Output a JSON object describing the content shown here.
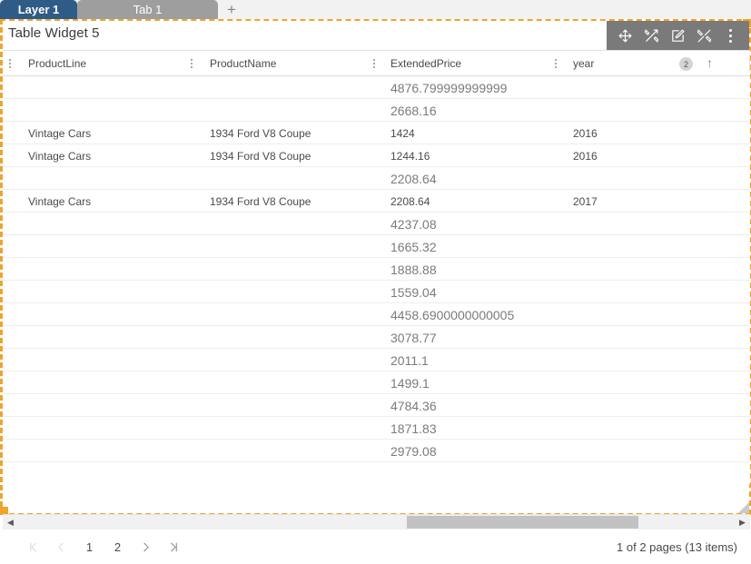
{
  "tabbar": {
    "layer_tab": "Layer 1",
    "sheet_tab": "Tab 1",
    "add_tab": "+"
  },
  "widget": {
    "title": "Table Widget 5",
    "toolbar": [
      {
        "name": "move-icon",
        "label": "Move"
      },
      {
        "name": "design-icon",
        "label": "Design"
      },
      {
        "name": "edit-icon",
        "label": "Edit"
      },
      {
        "name": "tools-icon",
        "label": "Tools"
      },
      {
        "name": "more-menu-icon",
        "label": "More"
      }
    ]
  },
  "table": {
    "columns": [
      {
        "key": "ProductLine",
        "label": "ProductLine"
      },
      {
        "key": "ProductName",
        "label": "ProductName"
      },
      {
        "key": "ExtendedPrice",
        "label": "ExtendedPrice"
      },
      {
        "key": "year",
        "label": "year"
      }
    ],
    "sort": {
      "column": "year",
      "order_badge": "2",
      "direction": "ascending",
      "arrow": "↑"
    },
    "rows": [
      {
        "ProductLine": "",
        "ProductName": "",
        "ExtendedPrice": "4876.799999999999",
        "year": "",
        "summary": true
      },
      {
        "ProductLine": "",
        "ProductName": "",
        "ExtendedPrice": "2668.16",
        "year": "",
        "summary": true
      },
      {
        "ProductLine": "Vintage Cars",
        "ProductName": "1934 Ford V8 Coupe",
        "ExtendedPrice": "1424",
        "year": "2016",
        "summary": false
      },
      {
        "ProductLine": "Vintage Cars",
        "ProductName": "1934 Ford V8 Coupe",
        "ExtendedPrice": "1244.16",
        "year": "2016",
        "summary": false
      },
      {
        "ProductLine": "",
        "ProductName": "",
        "ExtendedPrice": "2208.64",
        "year": "",
        "summary": true
      },
      {
        "ProductLine": "Vintage Cars",
        "ProductName": "1934 Ford V8 Coupe",
        "ExtendedPrice": "2208.64",
        "year": "2017",
        "summary": false
      },
      {
        "ProductLine": "",
        "ProductName": "",
        "ExtendedPrice": "4237.08",
        "year": "",
        "summary": true
      },
      {
        "ProductLine": "",
        "ProductName": "",
        "ExtendedPrice": "1665.32",
        "year": "",
        "summary": true
      },
      {
        "ProductLine": "",
        "ProductName": "",
        "ExtendedPrice": "1888.88",
        "year": "",
        "summary": true
      },
      {
        "ProductLine": "",
        "ProductName": "",
        "ExtendedPrice": "1559.04",
        "year": "",
        "summary": true
      },
      {
        "ProductLine": "",
        "ProductName": "",
        "ExtendedPrice": "4458.6900000000005",
        "year": "",
        "summary": true
      },
      {
        "ProductLine": "",
        "ProductName": "",
        "ExtendedPrice": "3078.77",
        "year": "",
        "summary": true
      },
      {
        "ProductLine": "",
        "ProductName": "",
        "ExtendedPrice": "2011.1",
        "year": "",
        "summary": true
      },
      {
        "ProductLine": "",
        "ProductName": "",
        "ExtendedPrice": "1499.1",
        "year": "",
        "summary": true
      },
      {
        "ProductLine": "",
        "ProductName": "",
        "ExtendedPrice": "4784.36",
        "year": "",
        "summary": true
      },
      {
        "ProductLine": "",
        "ProductName": "",
        "ExtendedPrice": "1871.83",
        "year": "",
        "summary": true
      },
      {
        "ProductLine": "",
        "ProductName": "",
        "ExtendedPrice": "2979.08",
        "year": "",
        "summary": true
      }
    ]
  },
  "pager": {
    "first_label": "⇤",
    "prev_label": "‹",
    "pages": [
      "1",
      "2"
    ],
    "current_page": "1",
    "next_label": "›",
    "last_label": "⇥",
    "info": "1 of 2 pages (13 items)"
  },
  "scrollbar": {
    "left_arrow": "◀",
    "right_arrow": "▶"
  },
  "colors": {
    "accent_orange": "#f0a32a",
    "active_tab_blue": "#2f5c87",
    "inactive_tab_gray": "#9e9e9e",
    "toolbar_gray": "#7a7a7a"
  }
}
